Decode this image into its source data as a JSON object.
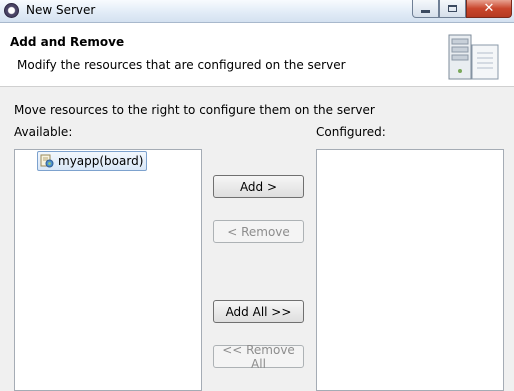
{
  "window": {
    "title": "New Server",
    "app_icon": "eclipse-icon",
    "controls": {
      "minimize": "minimize-icon",
      "maximize": "restore-icon",
      "close": "close-icon"
    }
  },
  "header": {
    "title": "Add and Remove",
    "description": "Modify the resources that are configured on the server",
    "graphic": "server-icon"
  },
  "instruction": "Move resources to the right to configure them on the server",
  "available": {
    "label": "Available:",
    "items": [
      {
        "label": "myapp(board)",
        "icon": "web-module-icon",
        "selected": true
      }
    ]
  },
  "configured": {
    "label": "Configured:",
    "items": []
  },
  "buttons": {
    "add": {
      "label": "Add >",
      "enabled": true
    },
    "remove": {
      "label": "< Remove",
      "enabled": false
    },
    "add_all": {
      "label": "Add All >>",
      "enabled": true
    },
    "remove_all": {
      "label": "<< Remove All",
      "enabled": false
    }
  },
  "colors": {
    "header_bg": "#ffffff",
    "dialog_bg": "#f0f0f0",
    "selection_border": "#7da2ce",
    "close_button": "#c9462c"
  }
}
